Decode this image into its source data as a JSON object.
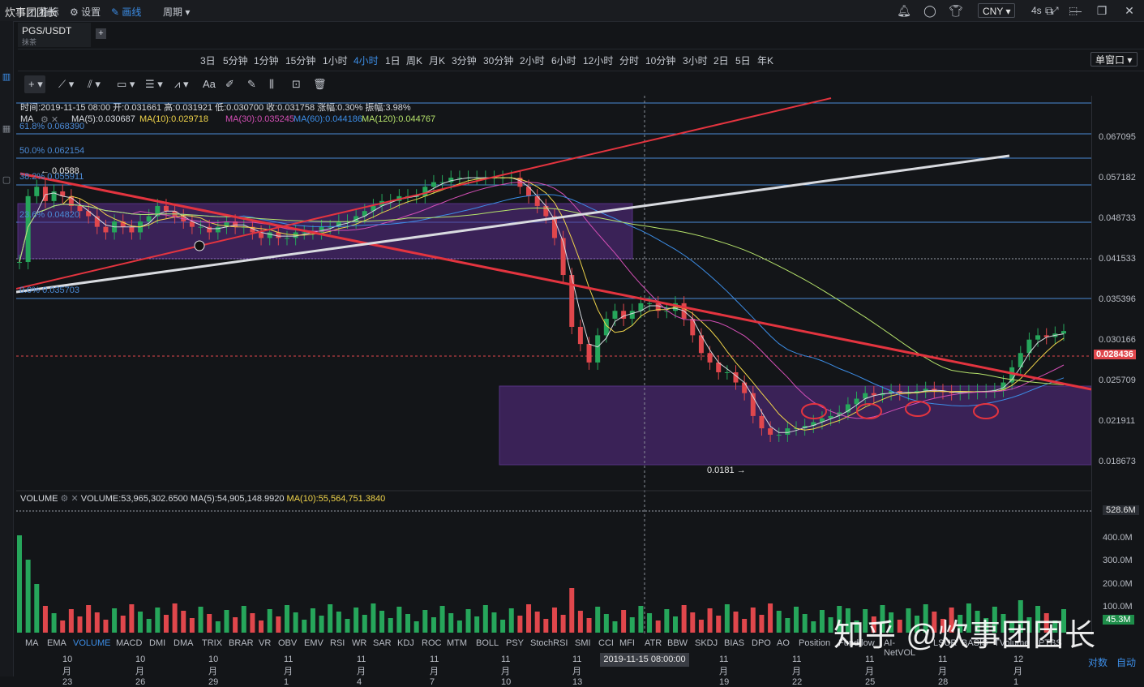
{
  "window": {
    "title": "炊事团团长",
    "currency": "CNY"
  },
  "symbol": {
    "pair": "PGS/USDT",
    "sub": "抹茶"
  },
  "toolbar": {
    "indicator_label": "指标",
    "settings_label": "设置",
    "draw_label": "画线",
    "period_label": "周期",
    "intervals": [
      "3日",
      "5分钟",
      "1分钟",
      "15分钟",
      "1小时",
      "4小时",
      "1日",
      "周K",
      "月K",
      "3分钟",
      "30分钟",
      "2小时",
      "6小时",
      "12小时",
      "分时",
      "10分钟",
      "3小时",
      "2日",
      "5日",
      "年K"
    ],
    "active_interval": "4小时",
    "refresh": "4s",
    "window_mode": "单窗口"
  },
  "ohlc_line": "时间:2019-11-15 08:00  开:0.031661  高:0.031921  低:0.030700  收:0.031758  涨幅:0.30%  振幅:3.98%",
  "ma_labels": {
    "ma": "MA",
    "ma5": "MA(5):0.030687",
    "ma10": "MA(10):0.029718",
    "ma30": "MA(30):0.035245",
    "ma60": "MA(60):0.044186",
    "ma120": "MA(120):0.044767"
  },
  "fib": {
    "f618": "61.8% 0.068390",
    "f50": "50.0% 0.062154",
    "f382": "38.2% 0.055911",
    "f236": "23.6% 0.04820",
    "f0": "0.0% 0.035703"
  },
  "annotations": {
    "high": "← 0.0588",
    "low": "0.0181 →"
  },
  "price_axis": [
    "0.067095",
    "0.057182",
    "0.048733",
    "0.041533",
    "0.035396",
    "0.030166",
    "0.028436",
    "0.025709",
    "0.021911",
    "0.018673"
  ],
  "volume": {
    "label": "VOLUME",
    "value": "VOLUME:53,965,302.6500",
    "ma5": "MA(5):54,905,148.9920",
    "ma10": "MA(10):55,564,751.3840",
    "axis": [
      "528.6M",
      "400.0M",
      "300.0M",
      "200.0M",
      "100.0M",
      "45.3M"
    ]
  },
  "indicators": [
    "MA",
    "EMA",
    "VOLUME",
    "MACD",
    "DMI",
    "DMA",
    "TRIX",
    "BRAR",
    "VR",
    "OBV",
    "EMV",
    "RSI",
    "WR",
    "SAR",
    "KDJ",
    "ROC",
    "MTM",
    "BOLL",
    "PSY",
    "StochRSI",
    "SMI",
    "CCI",
    "MFI",
    "ATR",
    "BBW",
    "SKDJ",
    "BIAS",
    "DPO",
    "AO",
    "Position",
    "Fundflow",
    "AI-NetVOL",
    "LSUR",
    "BASIS",
    "TVolume",
    "PTBS"
  ],
  "active_indicator": "VOLUME",
  "dates": [
    "10月23",
    "10月26",
    "10月29",
    "11月1",
    "11月4",
    "11月7",
    "11月10",
    "11月13",
    "11月19",
    "11月22",
    "11月25",
    "11月28",
    "12月1"
  ],
  "crosshair_date": "2019-11-15 08:00:00",
  "scale_modes": [
    "对数",
    "自动"
  ],
  "watermark": "知乎 @炊事团团长",
  "colors": {
    "up": "#26a65b",
    "down": "#e0474c",
    "accent": "#3c8de6",
    "box": "#5a2d8c",
    "trend": "#e3343f"
  },
  "chart_data": {
    "type": "candlestick",
    "price_range": [
      0.015,
      0.076
    ],
    "close_series": [
      0.038,
      0.05,
      0.052,
      0.049,
      0.051,
      0.05,
      0.048,
      0.047,
      0.046,
      0.044,
      0.043,
      0.045,
      0.044,
      0.043,
      0.045,
      0.046,
      0.048,
      0.047,
      0.046,
      0.045,
      0.044,
      0.044,
      0.043,
      0.044,
      0.045,
      0.044,
      0.044,
      0.043,
      0.042,
      0.043,
      0.042,
      0.042,
      0.043,
      0.043,
      0.043,
      0.044,
      0.044,
      0.045,
      0.045,
      0.046,
      0.047,
      0.048,
      0.049,
      0.049,
      0.05,
      0.05,
      0.05,
      0.052,
      0.053,
      0.053,
      0.054,
      0.054,
      0.054,
      0.054,
      0.054,
      0.054,
      0.054,
      0.054,
      0.052,
      0.05,
      0.048,
      0.046,
      0.042,
      0.036,
      0.029,
      0.027,
      0.025,
      0.028,
      0.03,
      0.031,
      0.03,
      0.031,
      0.032,
      0.032,
      0.031,
      0.031,
      0.032,
      0.03,
      0.028,
      0.026,
      0.025,
      0.024,
      0.024,
      0.023,
      0.022,
      0.02,
      0.019,
      0.0185,
      0.0185,
      0.019,
      0.019,
      0.0192,
      0.0195,
      0.0198,
      0.02,
      0.0203,
      0.021,
      0.0215,
      0.022,
      0.0218,
      0.022,
      0.0222,
      0.022,
      0.022,
      0.0222,
      0.0224,
      0.0222,
      0.0221,
      0.022,
      0.0221,
      0.0221,
      0.0222,
      0.0222,
      0.0223,
      0.023,
      0.0245,
      0.026,
      0.0275,
      0.028,
      0.0278,
      0.0282,
      0.0285
    ],
    "key_levels": {
      "high": 0.0588,
      "low": 0.0181,
      "last": 0.028436
    },
    "volume_axis_max": "528.6M"
  }
}
